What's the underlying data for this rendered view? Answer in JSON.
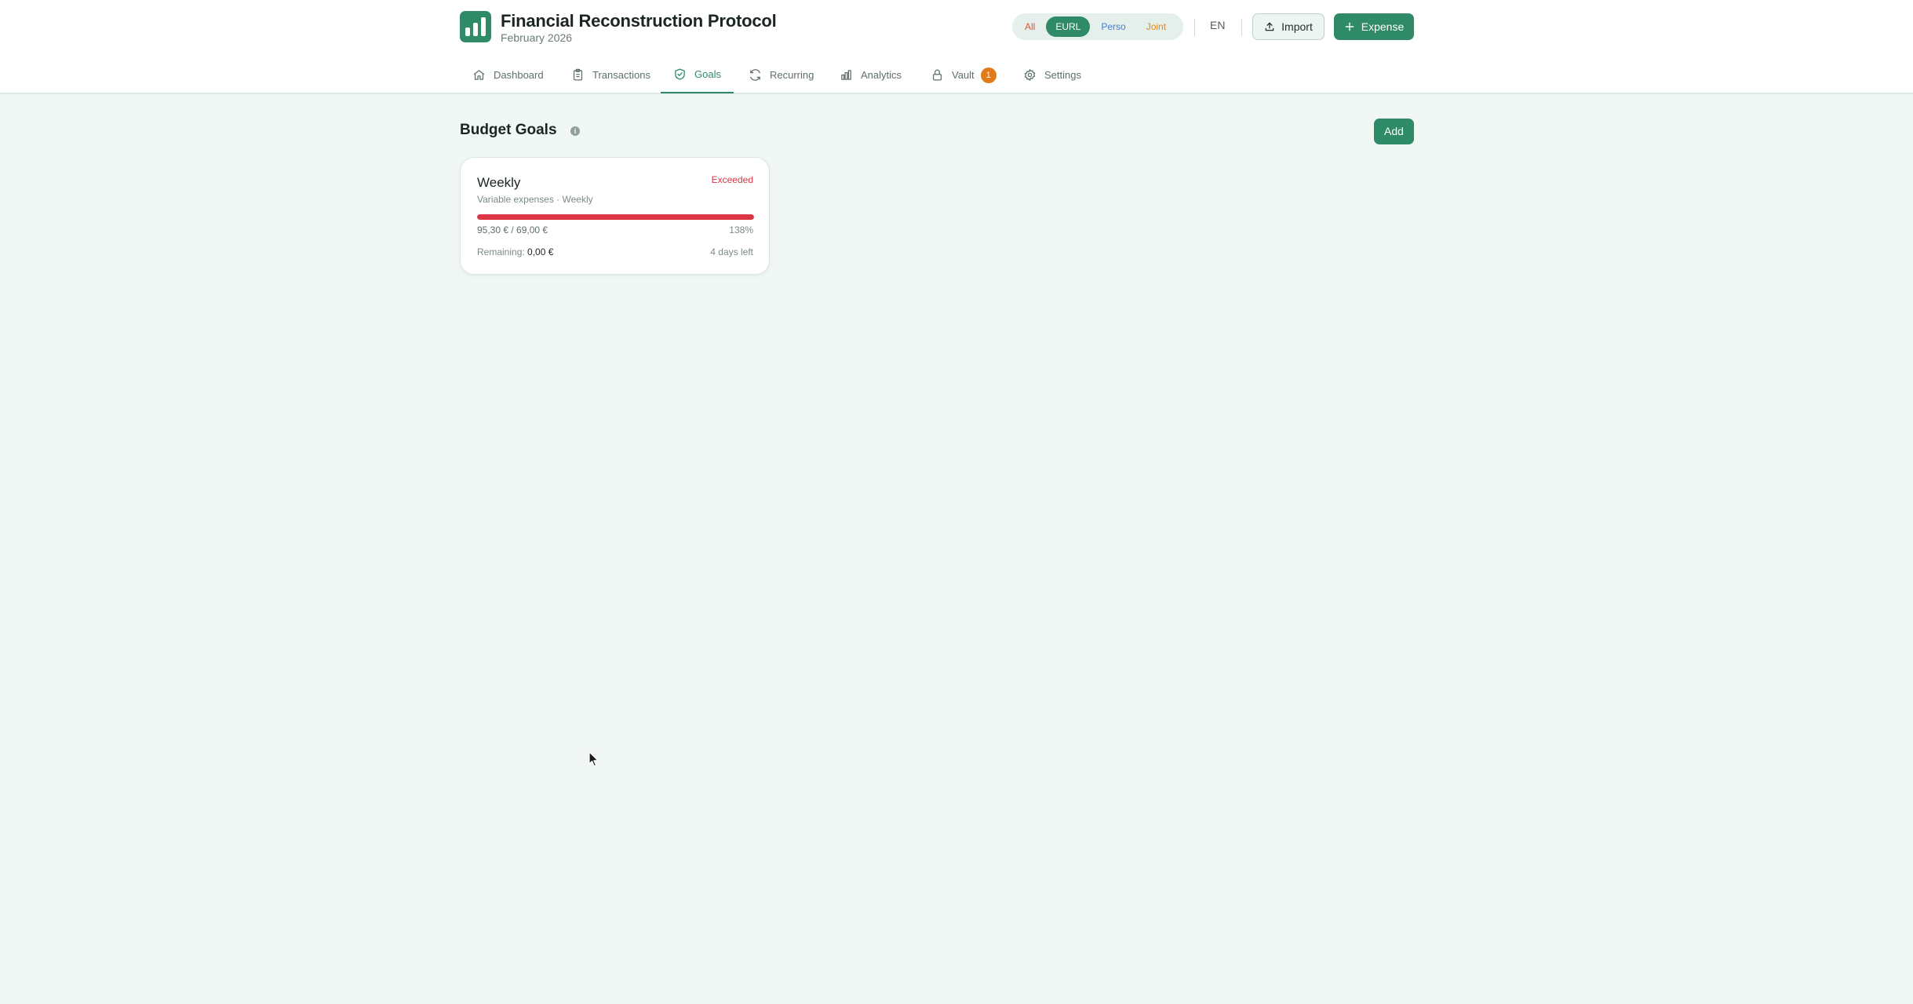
{
  "app": {
    "title": "Financial Reconstruction Protocol",
    "period": "February 2026"
  },
  "entity_filter": {
    "options": [
      {
        "label": "All",
        "color": "#e0523a"
      },
      {
        "label": "EURL",
        "color": "#2f8a67",
        "selected": true
      },
      {
        "label": "Perso",
        "color": "#3f7fd0"
      },
      {
        "label": "Joint",
        "color": "#e08a1a"
      }
    ]
  },
  "header": {
    "language": "EN",
    "import_label": "Import",
    "expense_label": "Expense"
  },
  "nav": {
    "tabs": [
      {
        "label": "Dashboard",
        "icon": "home-icon"
      },
      {
        "label": "Transactions",
        "icon": "clipboard-icon"
      },
      {
        "label": "Goals",
        "icon": "shield-check-icon",
        "active": true
      },
      {
        "label": "Recurring",
        "icon": "refresh-icon"
      },
      {
        "label": "Analytics",
        "icon": "bar-chart-icon"
      },
      {
        "label": "Vault",
        "icon": "lock-icon",
        "badge": "1"
      },
      {
        "label": "Settings",
        "icon": "gear-icon"
      }
    ]
  },
  "goals": {
    "section_title": "Budget Goals",
    "add_label": "Add",
    "items": [
      {
        "name": "Weekly",
        "meta": "Variable expenses · Weekly",
        "status": "Exceeded",
        "amount": "95,30 € / 69,00 €",
        "percent": "138%",
        "progress_fraction": 1.0,
        "remaining_label": "Remaining:",
        "remaining_value": "0,00 €",
        "days_left": "4 days left"
      }
    ]
  },
  "colors": {
    "accent": "#2f8a67",
    "danger": "#dc3545",
    "background": "#f1f7f5"
  }
}
